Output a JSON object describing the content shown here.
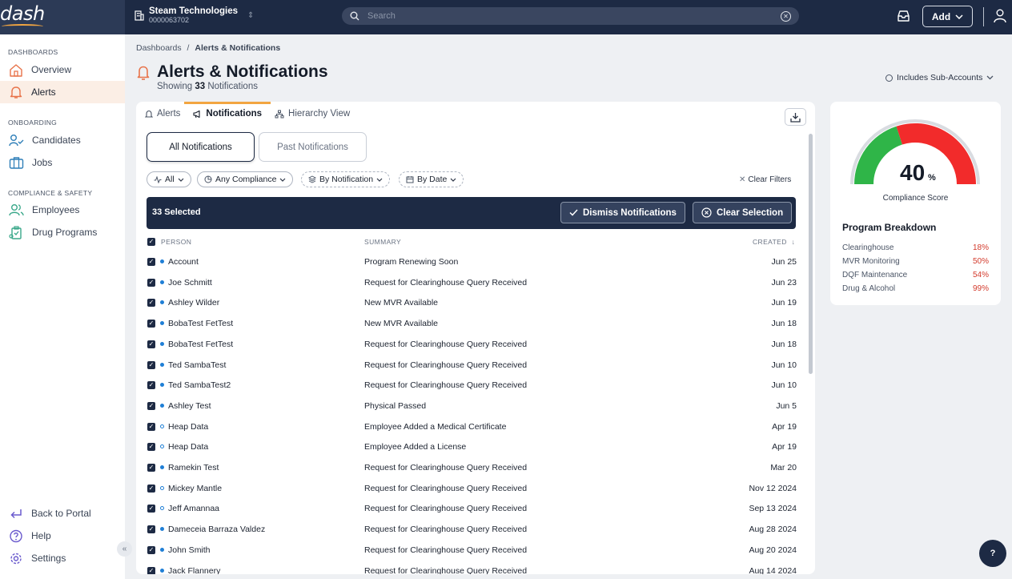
{
  "brand": {
    "logo": "dash"
  },
  "org": {
    "name": "Steam Technologies",
    "code": "0000063702"
  },
  "search": {
    "placeholder": "Search"
  },
  "topbar": {
    "add_label": "Add"
  },
  "sidebar": {
    "sections": [
      "DASHBOARDS",
      "ONBOARDING",
      "COMPLIANCE & SAFETY"
    ],
    "items": [
      {
        "label": "Overview",
        "icon": "home-icon"
      },
      {
        "label": "Alerts",
        "icon": "bell-icon"
      },
      {
        "label": "Candidates",
        "icon": "user-check-icon"
      },
      {
        "label": "Jobs",
        "icon": "briefcase-icon"
      },
      {
        "label": "Employees",
        "icon": "users-icon"
      },
      {
        "label": "Drug Programs",
        "icon": "clipboard-icon"
      }
    ],
    "footer": [
      {
        "label": "Back to Portal",
        "icon": "return-arrow-icon"
      },
      {
        "label": "Help",
        "icon": "help-circle-icon"
      },
      {
        "label": "Settings",
        "icon": "gear-icon"
      }
    ]
  },
  "breadcrumb": {
    "root": "Dashboards",
    "separator": "/",
    "current": "Alerts & Notifications"
  },
  "page": {
    "title": "Alerts & Notifications",
    "showing_prefix": "Showing",
    "count": "33",
    "showing_suffix": "Notifications"
  },
  "subaccounts": {
    "label": "Includes Sub-Accounts"
  },
  "tabs": [
    {
      "label": "Alerts"
    },
    {
      "label": "Notifications",
      "active": true
    },
    {
      "label": "Hierarchy View"
    }
  ],
  "segments": {
    "all": "All Notifications",
    "past": "Past Notifications"
  },
  "filters": [
    {
      "label": "All"
    },
    {
      "label": "Any Compliance"
    },
    {
      "label": "By Notification"
    },
    {
      "label": "By Date"
    }
  ],
  "clear_filters": "Clear Filters",
  "selection": {
    "count_label": "33 Selected",
    "dismiss_label": "Dismiss Notifications",
    "clear_label": "Clear Selection"
  },
  "table": {
    "headers": {
      "person": "PERSON",
      "summary": "SUMMARY",
      "created": "CREATED"
    },
    "rows": [
      {
        "person": "Account",
        "summary": "Program Renewing Soon",
        "created": "Jun 25",
        "unread": true
      },
      {
        "person": "Joe Schmitt",
        "summary": "Request for Clearinghouse Query Received",
        "created": "Jun 23",
        "unread": true
      },
      {
        "person": "Ashley Wilder",
        "summary": "New MVR Available",
        "created": "Jun 19",
        "unread": true
      },
      {
        "person": "BobaTest FetTest",
        "summary": "New MVR Available",
        "created": "Jun 18",
        "unread": true
      },
      {
        "person": "BobaTest FetTest",
        "summary": "Request for Clearinghouse Query Received",
        "created": "Jun 18",
        "unread": true
      },
      {
        "person": "Ted SambaTest",
        "summary": "Request for Clearinghouse Query Received",
        "created": "Jun 10",
        "unread": true
      },
      {
        "person": "Ted SambaTest2",
        "summary": "Request for Clearinghouse Query Received",
        "created": "Jun 10",
        "unread": true
      },
      {
        "person": "Ashley Test",
        "summary": "Physical Passed",
        "created": "Jun 5",
        "unread": true
      },
      {
        "person": "Heap Data",
        "summary": "Employee Added a Medical Certificate",
        "created": "Apr 19",
        "unread": false
      },
      {
        "person": "Heap Data",
        "summary": "Employee Added a License",
        "created": "Apr 19",
        "unread": false
      },
      {
        "person": "Ramekin Test",
        "summary": "Request for Clearinghouse Query Received",
        "created": "Mar 20",
        "unread": true
      },
      {
        "person": "Mickey Mantle",
        "summary": "Request for Clearinghouse Query Received",
        "created": "Nov 12 2024",
        "unread": false
      },
      {
        "person": "Jeff Amannaa",
        "summary": "Request for Clearinghouse Query Received",
        "created": "Sep 13 2024",
        "unread": false
      },
      {
        "person": "Dameceia Barraza Valdez",
        "summary": "Request for Clearinghouse Query Received",
        "created": "Aug 28 2024",
        "unread": true
      },
      {
        "person": "John Smith",
        "summary": "Request for Clearinghouse Query Received",
        "created": "Aug 20 2024",
        "unread": true
      },
      {
        "person": "Jack Flannery",
        "summary": "Request for Clearinghouse Query Received",
        "created": "Aug 14 2024",
        "unread": true
      }
    ]
  },
  "score": {
    "value": "40",
    "unit": "%",
    "fraction": 0.4,
    "label": "Compliance Score",
    "colors": {
      "good": "#2fb548",
      "bad": "#f22b2b"
    }
  },
  "breakdown": {
    "title": "Program Breakdown",
    "items": [
      {
        "label": "Clearinghouse",
        "value": "18%"
      },
      {
        "label": "MVR Monitoring",
        "value": "50%"
      },
      {
        "label": "DQF Maintenance",
        "value": "54%"
      },
      {
        "label": "Drug & Alcohol",
        "value": "99%"
      }
    ]
  },
  "help_fab": "?"
}
